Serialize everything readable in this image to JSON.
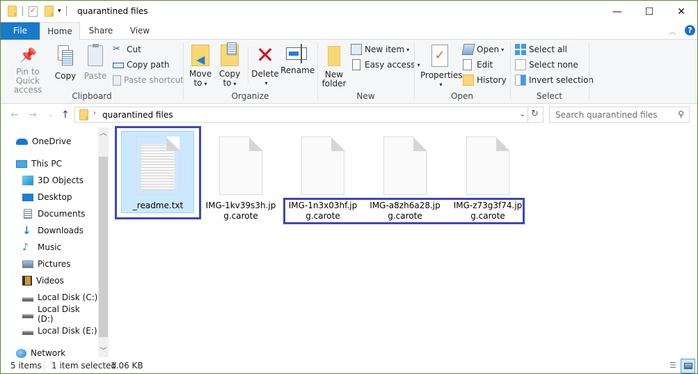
{
  "window": {
    "title": "quarantined files",
    "controls": {
      "minimize": "—",
      "maximize": "☐",
      "close": "✕"
    },
    "border_color": "#5a8a2a"
  },
  "ribbon_tabs": [
    {
      "label": "File",
      "active": false
    },
    {
      "label": "Home",
      "active": true
    },
    {
      "label": "Share",
      "active": false
    },
    {
      "label": "View",
      "active": false
    }
  ],
  "ribbon": {
    "clipboard": {
      "group_label": "Clipboard",
      "pin_line1": "Pin to Quick",
      "pin_line2": "access",
      "copy": "Copy",
      "paste": "Paste",
      "cut": "Cut",
      "copy_path": "Copy path",
      "paste_shortcut": "Paste shortcut"
    },
    "organize": {
      "group_label": "Organize",
      "move_line1": "Move",
      "move_line2": "to",
      "copy_line1": "Copy",
      "copy_line2": "to",
      "delete": "Delete",
      "rename": "Rename"
    },
    "new": {
      "group_label": "New",
      "new_folder_line1": "New",
      "new_folder_line2": "folder",
      "new_item": "New item",
      "easy_access": "Easy access"
    },
    "open": {
      "group_label": "Open",
      "properties": "Properties",
      "open": "Open",
      "edit": "Edit",
      "history": "History"
    },
    "select": {
      "group_label": "Select",
      "select_all": "Select all",
      "select_none": "Select none",
      "invert_selection": "Invert selection"
    }
  },
  "address_bar": {
    "path": "quarantined files",
    "search_placeholder": "Search quarantined files"
  },
  "sidebar": {
    "items": [
      {
        "label": "OneDrive",
        "icon": "onedrive-icon"
      },
      {
        "label": "This PC",
        "icon": "this-pc-icon"
      },
      {
        "label": "3D Objects",
        "icon": "3d-objects-icon"
      },
      {
        "label": "Desktop",
        "icon": "desktop-icon"
      },
      {
        "label": "Documents",
        "icon": "documents-icon"
      },
      {
        "label": "Downloads",
        "icon": "downloads-icon"
      },
      {
        "label": "Music",
        "icon": "music-icon"
      },
      {
        "label": "Pictures",
        "icon": "pictures-icon"
      },
      {
        "label": "Videos",
        "icon": "videos-icon"
      },
      {
        "label": "Local Disk (C:)",
        "icon": "drive-c-icon"
      },
      {
        "label": "Local Disk (D:)",
        "icon": "drive-icon"
      },
      {
        "label": "Local Disk (E:)",
        "icon": "drive-icon"
      },
      {
        "label": "Network",
        "icon": "network-icon"
      }
    ]
  },
  "files": [
    {
      "line1": "_readme.txt",
      "line2": "",
      "type": "text",
      "selected": true
    },
    {
      "line1": "IMG-1kv39s3h.jp",
      "line2": "g.carote",
      "type": "unknown",
      "selected": false
    },
    {
      "line1": "IMG-1n3x03hf.jp",
      "line2": "g.carote",
      "type": "unknown",
      "selected": false
    },
    {
      "line1": "IMG-a8zh6a28.jp",
      "line2": "g.carote",
      "type": "unknown",
      "selected": false
    },
    {
      "line1": "IMG-z73g3f74.jp",
      "line2": "g.carote",
      "type": "unknown",
      "selected": false
    }
  ],
  "highlight_color": "#3c45c8",
  "status_bar": {
    "item_count": "5 items",
    "selection": "1 item selected",
    "size": "1.06 KB"
  }
}
